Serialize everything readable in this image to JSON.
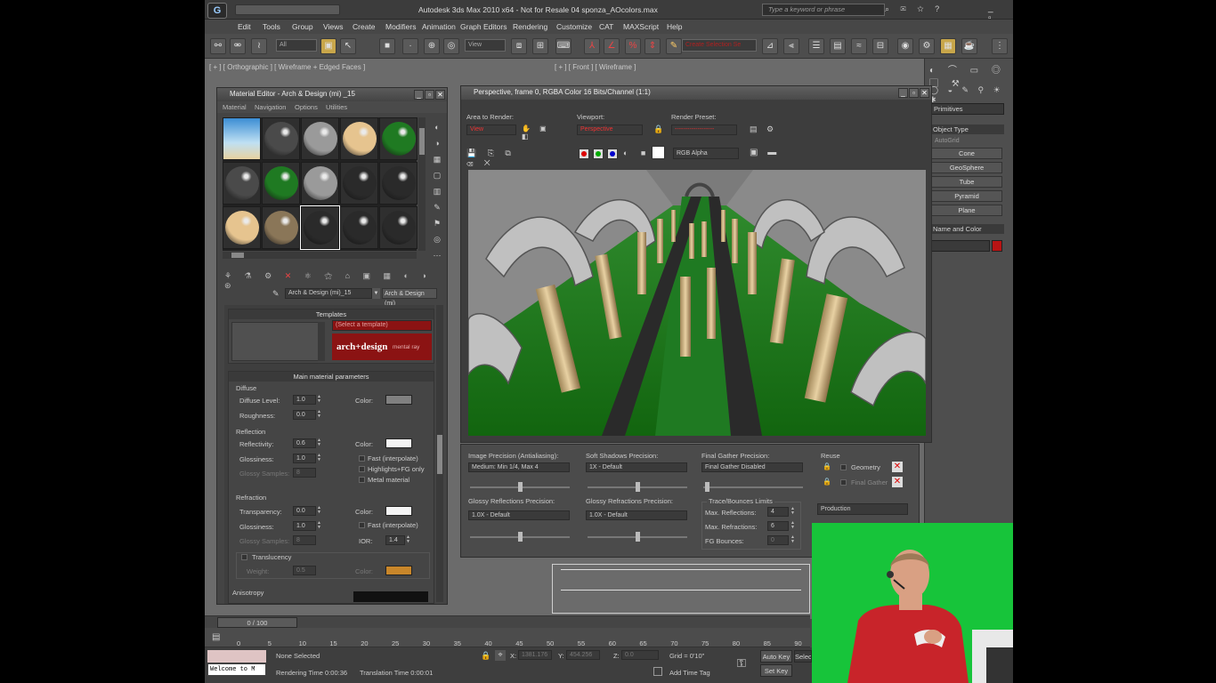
{
  "title_bar": {
    "title": "Autodesk 3ds Max  2010 x64  - Not for Resale    04 sponza_AOcolors.max",
    "search_placeholder": "Type a keyword or phrase"
  },
  "menu": [
    "Edit",
    "Tools",
    "Group",
    "Views",
    "Create",
    "Modifiers",
    "Animation",
    "Graph Editors",
    "Rendering",
    "Customize",
    "CAT",
    "MAXScript",
    "Help"
  ],
  "toolbar": {
    "selection_filter": "All",
    "ref_coord": "View",
    "named_selection": "Create Selection Se"
  },
  "viewports": {
    "top_left_label": "[ + ] [ Orthographic ] [ Wireframe + Edged Faces ]",
    "top_right_label": "[ + ] [ Front ] [ Wireframe ]"
  },
  "material_editor": {
    "title": "Material Editor - Arch & Design (mi) _15",
    "menu": [
      "Material",
      "Navigation",
      "Options",
      "Utilities"
    ],
    "sphere_colors": [
      "#a8c8e0",
      "#4a4a4a",
      "#9a9a9a",
      "#e6c48f",
      "#1f7a22",
      "#4a4a4a",
      "#1f7a22",
      "#9a9a9a",
      "#2a2a2a",
      "#2a2a2a",
      "#e6c48f",
      "#8a7658",
      "#2a2a2a",
      "#2a2a2a",
      "#2a2a2a"
    ],
    "material_name": "Arch & Design (mi)_15",
    "material_type": "Arch & Design (mi)",
    "templates_header": "Templates",
    "template_select": "(Select a template)",
    "logo_text": "arch+design",
    "logo_sub": "mental ray",
    "main_params_header": "Main material parameters",
    "diffuse": {
      "group": "Diffuse",
      "level_label": "Diffuse Level:",
      "level": "1.0",
      "color_label": "Color:",
      "roughness_label": "Roughness:",
      "roughness": "0.0"
    },
    "reflection": {
      "group": "Reflection",
      "reflectivity_label": "Reflectivity:",
      "reflectivity": "0.6",
      "color_label": "Color:",
      "glossiness_label": "Glossiness:",
      "glossiness": "1.0",
      "samples_label": "Glossy Samples:",
      "samples": "8",
      "opt1": "Fast (interpolate)",
      "opt2": "Highlights+FG only",
      "opt3": "Metal material"
    },
    "refraction": {
      "group": "Refraction",
      "transparency_label": "Transparency:",
      "transparency": "0.0",
      "color_label": "Color:",
      "glossiness_label": "Glossiness:",
      "glossiness": "1.0",
      "samples_label": "Glossy Samples:",
      "samples": "8",
      "opt1": "Fast (interpolate)",
      "ior_label": "IOR:",
      "ior": "1.4"
    },
    "translucency": {
      "group": "Translucency",
      "weight_label": "Weight:",
      "weight": "0.5",
      "color_label": "Color:"
    },
    "anisotropy_label": "Anisotropy"
  },
  "render_window": {
    "title": "Perspective, frame 0, RGBA Color 16 Bits/Channel (1:1)",
    "area_label": "Area to Render:",
    "area_value": "View",
    "viewport_label": "Viewport:",
    "viewport_value": "Perspective",
    "preset_label": "Render Preset:",
    "preset_value": "-------------------",
    "channel_value": "RGB Alpha"
  },
  "render_settings": {
    "image_precision_label": "Image Precision (Antialiasing):",
    "image_precision": "Medium: Min 1/4, Max 4",
    "soft_shadows_label": "Soft Shadows Precision:",
    "soft_shadows": "1X - Default",
    "final_gather_label": "Final Gather Precision:",
    "final_gather": "Final Gather Disabled",
    "reuse_label": "Reuse",
    "geometry_label": "Geometry",
    "final_gather_reuse_label": "Final Gather",
    "glossy_refl_label": "Glossy Reflections Precision:",
    "glossy_refl": "1.0X - Default",
    "glossy_refr_label": "Glossy Refractions Precision:",
    "glossy_refr": "1.0X - Default",
    "trace_label": "Trace/Bounces Limits",
    "max_refl_label": "Max. Reflections:",
    "max_refl": "4",
    "max_refr_label": "Max. Refractions:",
    "max_refr": "6",
    "fg_bounces_label": "FG Bounces:",
    "fg_bounces": "0",
    "mode": "Production"
  },
  "command_panel": {
    "dropdown": "Primitives",
    "object_type": "Object Type",
    "autogrid": "AutoGrid",
    "buttons": [
      "Cone",
      "GeoSphere",
      "Tube",
      "Pyramid",
      "Plane"
    ],
    "name_color": "Name and Color"
  },
  "timeline": {
    "frame_counter": "0 / 100",
    "ticks": [
      "0",
      "5",
      "10",
      "15",
      "20",
      "25",
      "30",
      "35",
      "40",
      "45",
      "50",
      "55",
      "60",
      "65",
      "70",
      "75",
      "80",
      "85",
      "90"
    ]
  },
  "status": {
    "listener": "Welcome to M",
    "selection": "None Selected",
    "render_time": "Rendering Time  0:00:36",
    "translation_time": "Translation Time  0:00:01",
    "x_label": "X:",
    "x_value": "1381.176",
    "y_label": "Y:",
    "y_value": "454.256",
    "z_label": "Z:",
    "z_value": "0.0",
    "grid": "Grid = 0'10\"",
    "add_time_tag": "Add Time Tag",
    "auto_key": "Auto Key",
    "selected": "Selec",
    "set_key": "Set Key"
  },
  "colors": {
    "accent_red": "#b81414",
    "render_green": "#1f7a22",
    "webcam_green": "#16c83c"
  }
}
